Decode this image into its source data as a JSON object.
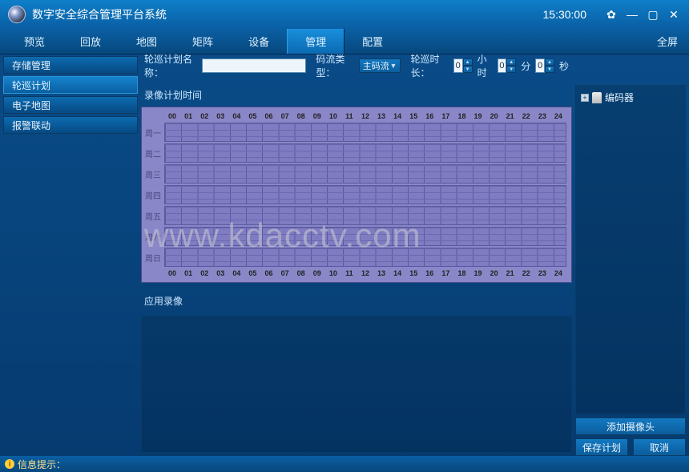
{
  "titlebar": {
    "app_title": "数字安全综合管理平台系统",
    "time": "15:30:00"
  },
  "tabs": {
    "items": [
      "预览",
      "回放",
      "地图",
      "矩阵",
      "设备",
      "管理",
      "配置"
    ],
    "active_index": 5,
    "fullscreen": "全屏"
  },
  "sidebar": {
    "items": [
      "存储管理",
      "轮巡计划",
      "电子地图",
      "报警联动"
    ],
    "active_index": 1
  },
  "filters": {
    "plan_name_label": "轮巡计划名称：",
    "plan_name_value": "",
    "stream_type_label": "码流类型：",
    "stream_type_value": "主码流",
    "duration_label": "轮巡时长：",
    "hours_value": "0",
    "hours_unit": "小时",
    "minutes_value": "0",
    "minutes_unit": "分",
    "seconds_value": "0",
    "seconds_unit": "秒"
  },
  "schedule": {
    "section_label": "录像计划时间",
    "hours": [
      "00",
      "01",
      "02",
      "03",
      "04",
      "05",
      "06",
      "07",
      "08",
      "09",
      "10",
      "11",
      "12",
      "13",
      "14",
      "15",
      "16",
      "17",
      "18",
      "19",
      "20",
      "21",
      "22",
      "23",
      "24"
    ],
    "days": [
      "周一",
      "周二",
      "周三",
      "周四",
      "周五",
      "周六",
      "周日"
    ]
  },
  "apply": {
    "section_label": "应用录像"
  },
  "rightpanel": {
    "tree_root_label": "编码器",
    "add_camera": "添加摄像头",
    "save_plan": "保存计划",
    "cancel": "取消"
  },
  "statusbar": {
    "info_label": "信息提示："
  },
  "watermark": "www.kdacctv.com",
  "colors": {
    "accent": "#0e7ec9",
    "panel_border": "#0a3c66",
    "schedule_bg": "#8a87c8"
  }
}
